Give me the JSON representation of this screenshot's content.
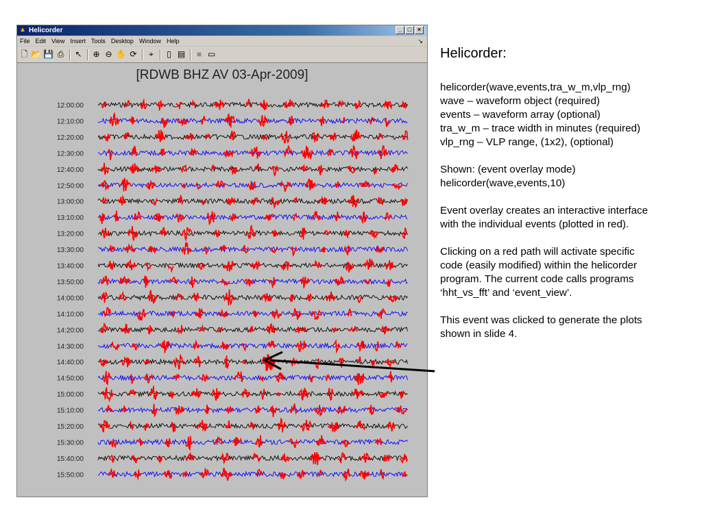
{
  "window": {
    "title": "Helicorder",
    "menu": [
      "File",
      "Edit",
      "View",
      "Insert",
      "Tools",
      "Desktop",
      "Window",
      "Help"
    ],
    "toolbar_icons": [
      "new-figure-icon",
      "open-file-icon",
      "save-icon",
      "print-icon",
      "edit-plot-icon",
      "zoom-in-icon",
      "zoom-out-icon",
      "pan-icon",
      "rotate-3d-icon",
      "data-cursor-icon",
      "colorbar-icon",
      "legend-icon",
      "hide-plot-tools-icon",
      "show-plot-tools-icon"
    ]
  },
  "plot": {
    "title": "[RDWB BHZ AV 03-Apr-2009]",
    "trace_labels": [
      "12:00:00",
      "12:10:00",
      "12:20:00",
      "12:30:00",
      "12:40:00",
      "12:50:00",
      "13:00:00",
      "13:10:00",
      "13:20:00",
      "13:30:00",
      "13:40:00",
      "13:50:00",
      "14:00:00",
      "14:10:00",
      "14:20:00",
      "14:30:00",
      "14:40:00",
      "14:50:00",
      "15:00:00",
      "15:10:00",
      "15:20:00",
      "15:30:00",
      "15:40:00",
      "15:50:00"
    ],
    "trace_colors": [
      "#000000",
      "#0000ff"
    ],
    "event_color": "#ff0000"
  },
  "panel": {
    "title": "Helicorder:",
    "usage": [
      "helicorder(wave,events,tra_w_m,vlp_rng)",
      "wave – waveform object (required)",
      "events – waveform array (optional)",
      "tra_w_m – trace width in minutes (required)",
      "vlp_rng – VLP range, (1x2), (optional)"
    ],
    "shown": [
      "Shown: (event overlay mode)",
      "helicorder(wave,events,10)"
    ],
    "overlay": [
      "Event overlay creates an interactive interface",
      "with the individual events (plotted in red)."
    ],
    "clicking": [
      "Clicking on a red path will activate specific",
      "code (easily modified) within the helicorder",
      "program.  The current code calls programs",
      "‘hht_vs_fft’ and ‘event_view’."
    ],
    "clicked": [
      "This event was clicked to generate the plots",
      "shown in slide 4."
    ]
  }
}
